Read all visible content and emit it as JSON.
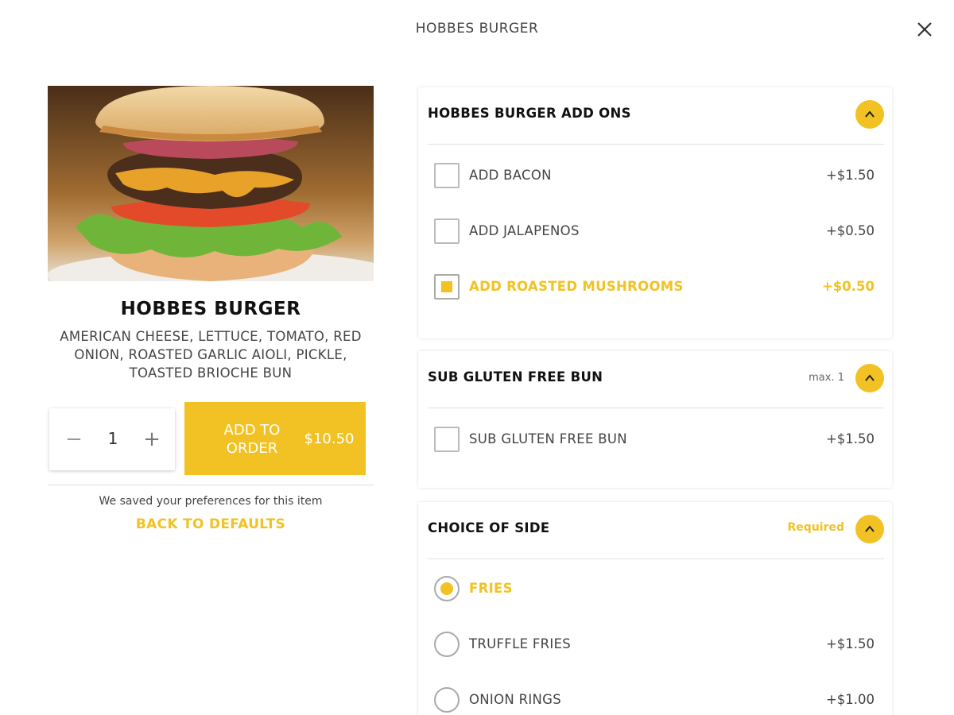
{
  "header": {
    "title": "HOBBES BURGER",
    "close_icon": "close-icon"
  },
  "item": {
    "image_icon": "burger-photo",
    "name": "HOBBES BURGER",
    "description": "AMERICAN CHEESE, LETTUCE, TOMATO, RED ONION, ROASTED GARLIC AIOLI, PICKLE, TOASTED BRIOCHE BUN",
    "quantity": "1",
    "minus_symbol": "−",
    "plus_symbol": "+",
    "add_button_label": "ADD TO ORDER",
    "add_button_price": "$10.50",
    "saved_note": "We saved your preferences for this item",
    "back_to_defaults": "BACK TO DEFAULTS"
  },
  "sections": [
    {
      "title": "HOBBES BURGER ADD ONS",
      "meta": "",
      "options": [
        {
          "label": "ADD BACON",
          "price": "+$1.50",
          "checked": false
        },
        {
          "label": "ADD JALAPENOS",
          "price": "+$0.50",
          "checked": false
        },
        {
          "label": "ADD ROASTED MUSHROOMS",
          "price": "+$0.50",
          "checked": true
        }
      ]
    },
    {
      "title": "SUB GLUTEN FREE BUN",
      "meta": "max. 1",
      "options": [
        {
          "label": "SUB GLUTEN FREE BUN",
          "price": "+$1.50",
          "checked": false
        }
      ]
    },
    {
      "title": "CHOICE OF SIDE",
      "meta": "Required",
      "options": [
        {
          "label": "FRIES",
          "price": "",
          "checked": true
        },
        {
          "label": "TRUFFLE FRIES",
          "price": "+$1.50",
          "checked": false
        },
        {
          "label": "ONION RINGS",
          "price": "+$1.00",
          "checked": false
        }
      ]
    }
  ],
  "colors": {
    "accent": "#f2c224",
    "text": "#444444",
    "heading": "#111111"
  }
}
